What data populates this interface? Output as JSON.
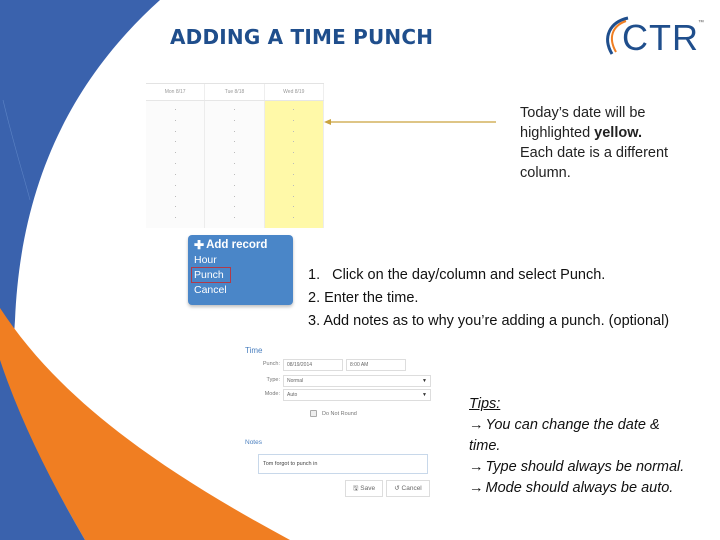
{
  "slide": {
    "title": "ADDING A TIME PUNCH",
    "colors": {
      "title": "#1f4e8c",
      "blue_band": "#3a62ad",
      "orange_band": "#f07e22",
      "today_highlight": "#fff9a8",
      "menu_bg": "#4a86c8"
    }
  },
  "logo": {
    "text": "CTR",
    "trademark": "™"
  },
  "calendar": {
    "columns": [
      {
        "label": "Mon 8/17",
        "today": false
      },
      {
        "label": "Tue 8/18",
        "today": false
      },
      {
        "label": "Wed 8/19",
        "today": true
      }
    ]
  },
  "callout_today": {
    "line1": "Today’s date will be",
    "line2_prefix": "highlighted ",
    "line2_bold": "yellow.",
    "line3": "Each date is a different",
    "line4": "column."
  },
  "add_record_menu": {
    "title": "Add record",
    "icon": "plus-icon",
    "items": [
      "Hour",
      "Punch",
      "Cancel"
    ],
    "highlighted_item": "Punch"
  },
  "steps": {
    "step1_num": "1.",
    "step1_text": "Click on the day/column and select Punch.",
    "step2": "2. Enter the time.",
    "step3": "3. Add notes as to why you’re adding a punch. (optional)"
  },
  "time_form": {
    "section_title": "Time",
    "punch_label": "Punch:",
    "punch_date": "08/19/2014",
    "punch_time": "8:00 AM",
    "type_label": "Type:",
    "type_value": "Normal",
    "mode_label": "Mode:",
    "mode_value": "Auto",
    "do_not_round_label": "Do Not Round",
    "do_not_round_checked": false,
    "notes_title": "Notes",
    "notes_value": "Tom forgot to punch in",
    "save_label": "Save",
    "cancel_label": "Cancel"
  },
  "tips": {
    "title": "Tips:",
    "arrow": "→",
    "tip1a": "You can change the date &",
    "tip1b": "time.",
    "tip2": "Type should always be normal.",
    "tip3": "Mode should always be auto."
  }
}
